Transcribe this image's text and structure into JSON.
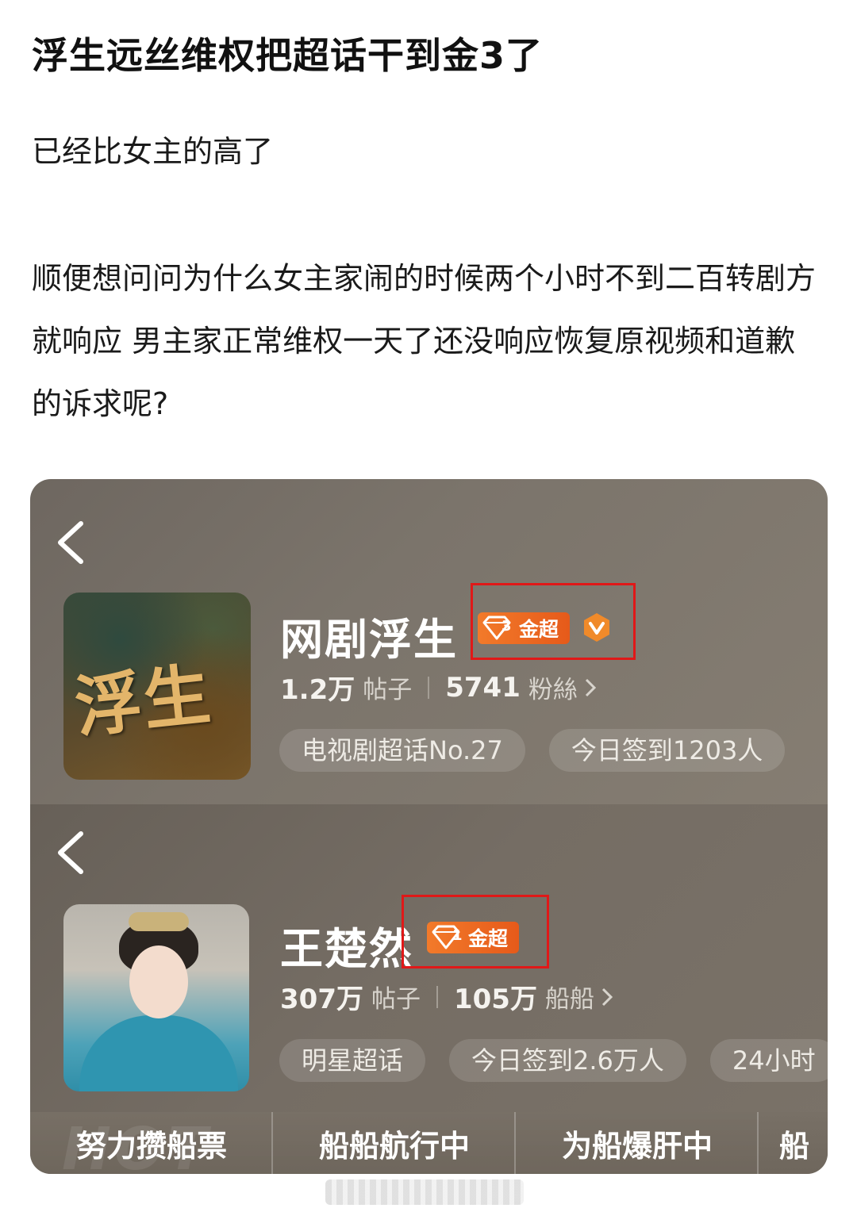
{
  "post": {
    "title": "浮生远丝维权把超话干到金3了",
    "paragraph1": "已经比女主的高了",
    "paragraph2": "顺便想问问为什么女主家闹的时候两个小时不到二百转剧方就响应 男主家正常维权一天了还没响应恢复原视频和道歉的诉求呢?"
  },
  "screenshot": {
    "card1": {
      "back_icon": "chevron-left-icon",
      "cover_text": "浮生",
      "name": "网剧浮生",
      "badge_label": "金超",
      "badge_level": "3",
      "verified_icon": "verified-v-icon",
      "stats": {
        "posts_value": "1.2万",
        "posts_label": "帖子",
        "fans_value": "5741",
        "fans_label": "粉絲"
      },
      "chips": [
        "电视剧超话No.27",
        "今日签到1203人"
      ]
    },
    "card2": {
      "back_icon": "chevron-left-icon",
      "name": "王楚然",
      "badge_label": "金超",
      "badge_level": "1",
      "stats": {
        "posts_value": "307万",
        "posts_label": "帖子",
        "fans_value": "105万",
        "fans_label": "船船"
      },
      "chips": [
        "明星超话",
        "今日签到2.6万人",
        "24小时"
      ],
      "tabs": [
        "努力攒船票",
        "船船航行中",
        "为船爆肝中",
        "船"
      ],
      "tab_bg_text": "HOT"
    },
    "colors": {
      "badge_orange": "#f0702a",
      "highlight_red": "#e01818"
    }
  }
}
